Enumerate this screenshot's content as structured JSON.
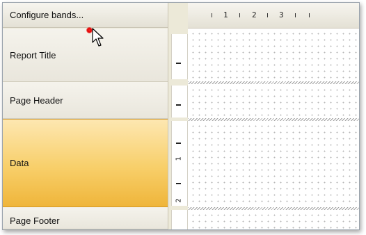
{
  "header": {
    "configure_label": "Configure bands..."
  },
  "bands": [
    {
      "label": "Report Title"
    },
    {
      "label": "Page Header"
    },
    {
      "label": "Data"
    },
    {
      "label": "Page Footer"
    }
  ],
  "ruler": {
    "horizontal_labels": [
      "1",
      "2",
      "3"
    ],
    "vertical_labels": [
      "1",
      "2"
    ]
  },
  "colors": {
    "selected_band": "#f8cf6a",
    "panel": "#ece9d8"
  }
}
